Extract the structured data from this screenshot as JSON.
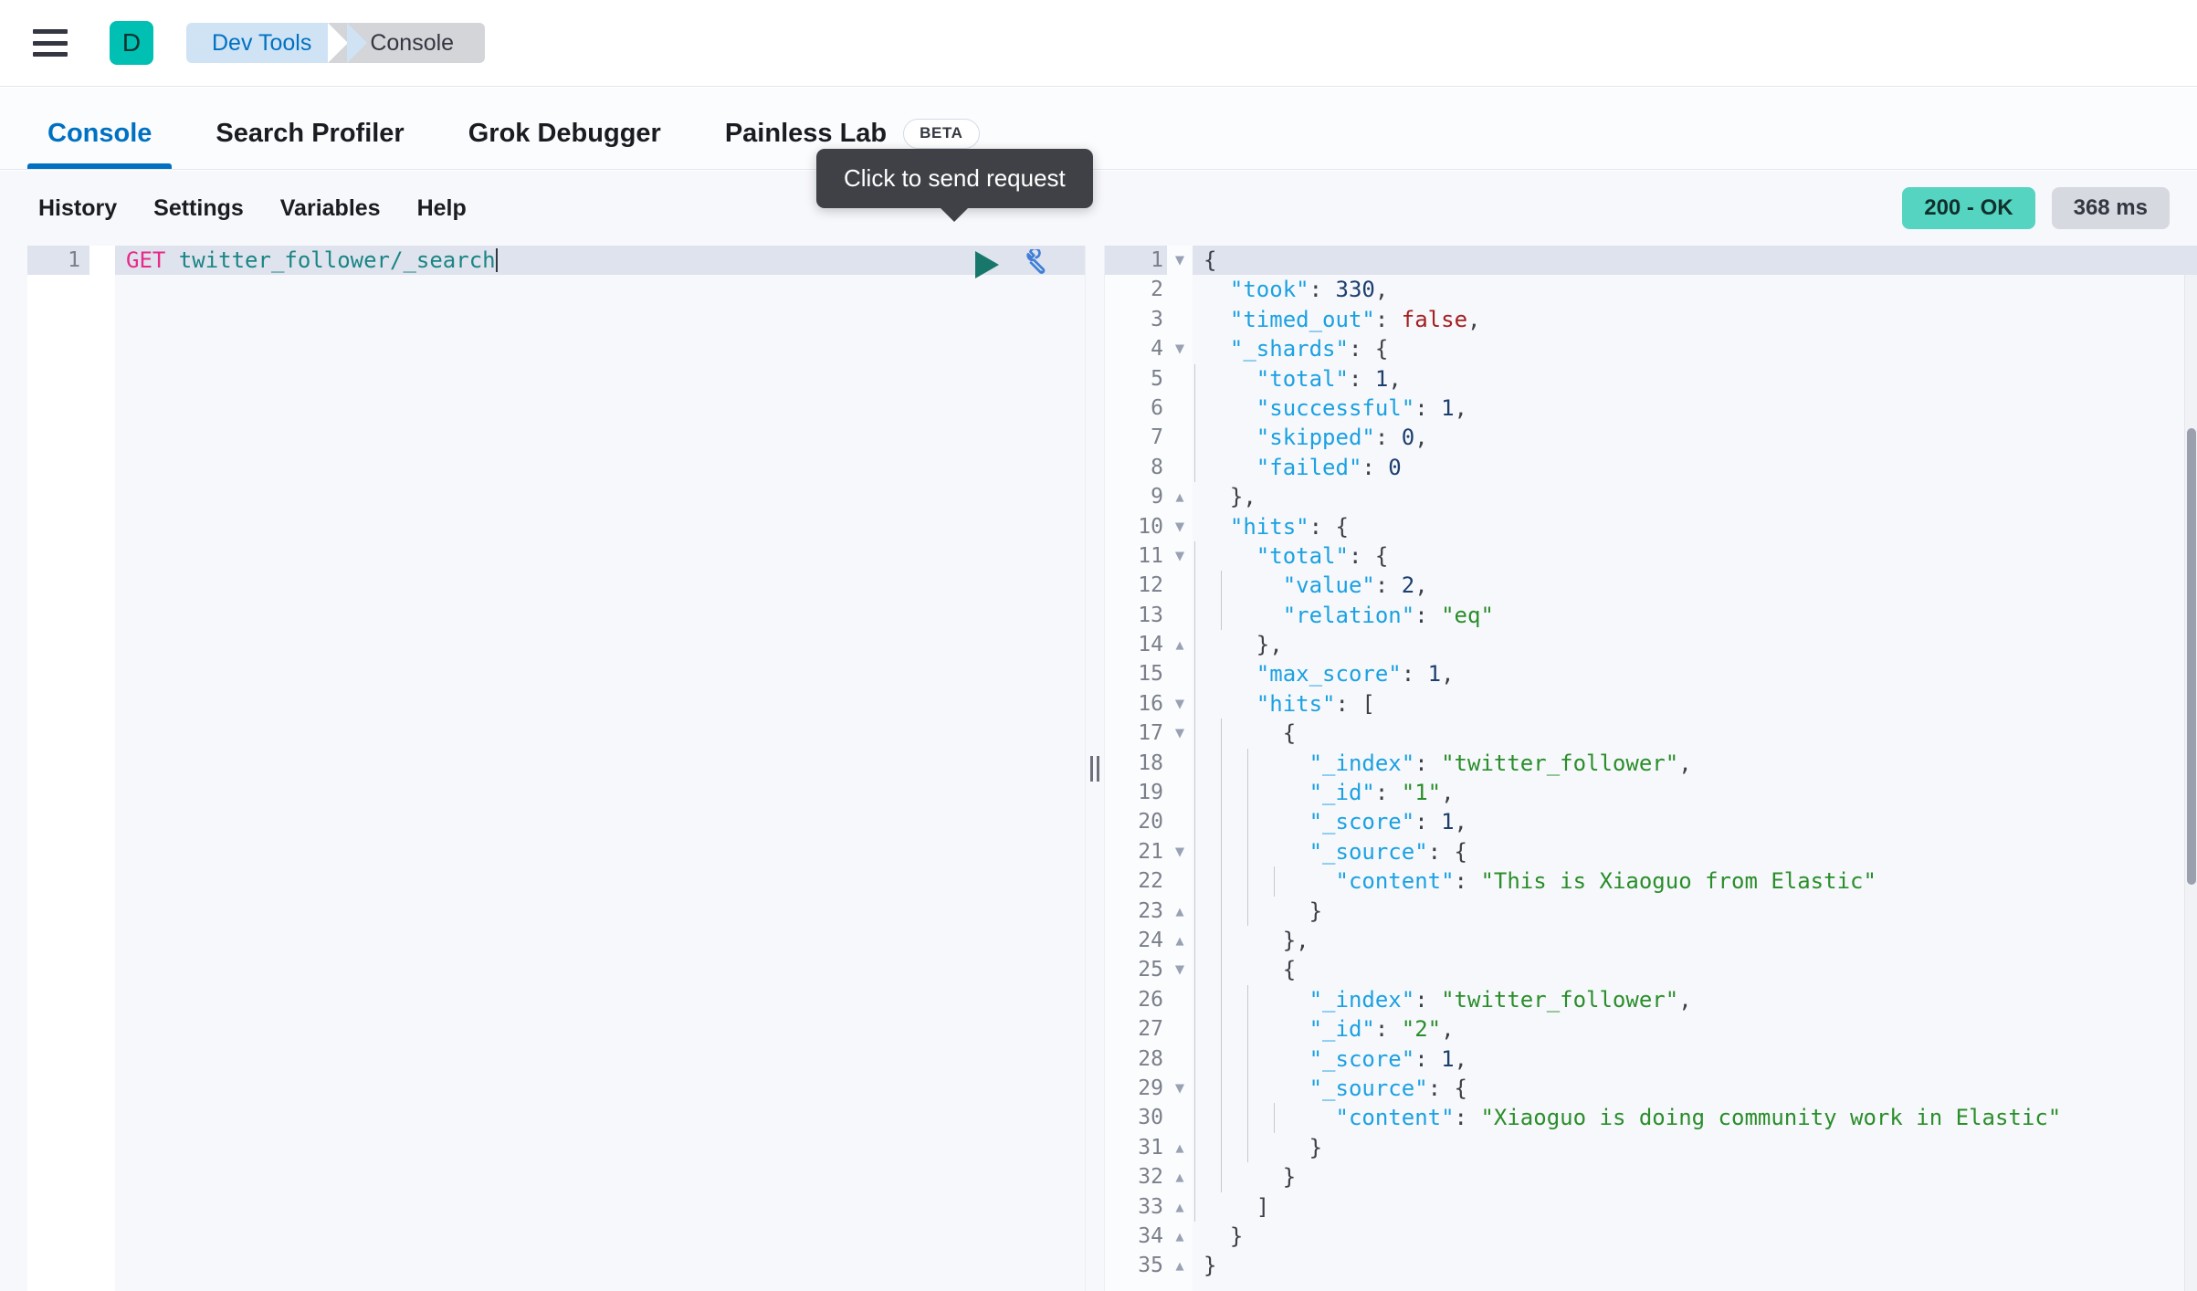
{
  "chrome": {
    "menu_icon": "hamburger-menu-icon",
    "app_badge_letter": "D",
    "breadcrumbs": [
      {
        "label": "Dev Tools",
        "active": true
      },
      {
        "label": "Console",
        "active": false
      }
    ],
    "accent_teal": "#00bfb3",
    "accent_blue": "#0071c2"
  },
  "tabs": [
    {
      "label": "Console",
      "active": true,
      "badge": null
    },
    {
      "label": "Search Profiler",
      "active": false,
      "badge": null
    },
    {
      "label": "Grok Debugger",
      "active": false,
      "badge": null
    },
    {
      "label": "Painless Lab",
      "active": false,
      "badge": "BETA"
    }
  ],
  "action_row": {
    "links": [
      "History",
      "Settings",
      "Variables",
      "Help"
    ],
    "status_code": "200 - OK",
    "status_color": "#54d4c1",
    "duration": "368 ms",
    "duration_color": "#d7d9e0"
  },
  "tooltip": {
    "text": "Click to send request"
  },
  "request_editor": {
    "icons": {
      "send": "play-icon",
      "wrench": "wrench-icon"
    },
    "lines": [
      {
        "n": "1",
        "method": "GET",
        "url": " twitter_follower/_search",
        "active": true
      }
    ]
  },
  "response_editor": {
    "lines": [
      {
        "n": "1",
        "fold": "down",
        "indent": 0,
        "guides": 0,
        "text": "{"
      },
      {
        "n": "2",
        "fold": "",
        "indent": 1,
        "guides": 0,
        "key": "\"took\"",
        "sep": ": ",
        "num": "330",
        "tail": ","
      },
      {
        "n": "3",
        "fold": "",
        "indent": 1,
        "guides": 0,
        "key": "\"timed_out\"",
        "sep": ": ",
        "bool": "false",
        "tail": ","
      },
      {
        "n": "4",
        "fold": "down",
        "indent": 1,
        "guides": 0,
        "key": "\"_shards\"",
        "sep": ": ",
        "text": "{"
      },
      {
        "n": "5",
        "fold": "",
        "indent": 2,
        "guides": 1,
        "key": "\"total\"",
        "sep": ": ",
        "num": "1",
        "tail": ","
      },
      {
        "n": "6",
        "fold": "",
        "indent": 2,
        "guides": 1,
        "key": "\"successful\"",
        "sep": ": ",
        "num": "1",
        "tail": ","
      },
      {
        "n": "7",
        "fold": "",
        "indent": 2,
        "guides": 1,
        "key": "\"skipped\"",
        "sep": ": ",
        "num": "0",
        "tail": ","
      },
      {
        "n": "8",
        "fold": "",
        "indent": 2,
        "guides": 1,
        "key": "\"failed\"",
        "sep": ": ",
        "num": "0",
        "tail": ""
      },
      {
        "n": "9",
        "fold": "up",
        "indent": 1,
        "guides": 0,
        "text": "},"
      },
      {
        "n": "10",
        "fold": "down",
        "indent": 1,
        "guides": 0,
        "key": "\"hits\"",
        "sep": ": ",
        "text": "{"
      },
      {
        "n": "11",
        "fold": "down",
        "indent": 2,
        "guides": 1,
        "key": "\"total\"",
        "sep": ": ",
        "text": "{"
      },
      {
        "n": "12",
        "fold": "",
        "indent": 3,
        "guides": 2,
        "key": "\"value\"",
        "sep": ": ",
        "num": "2",
        "tail": ","
      },
      {
        "n": "13",
        "fold": "",
        "indent": 3,
        "guides": 2,
        "key": "\"relation\"",
        "sep": ": ",
        "str": "\"eq\"",
        "tail": ""
      },
      {
        "n": "14",
        "fold": "up",
        "indent": 2,
        "guides": 1,
        "text": "},"
      },
      {
        "n": "15",
        "fold": "",
        "indent": 2,
        "guides": 1,
        "key": "\"max_score\"",
        "sep": ": ",
        "num": "1",
        "tail": ","
      },
      {
        "n": "16",
        "fold": "down",
        "indent": 2,
        "guides": 1,
        "key": "\"hits\"",
        "sep": ": ",
        "text": "["
      },
      {
        "n": "17",
        "fold": "down",
        "indent": 3,
        "guides": 2,
        "text": "{"
      },
      {
        "n": "18",
        "fold": "",
        "indent": 4,
        "guides": 3,
        "key": "\"_index\"",
        "sep": ": ",
        "str": "\"twitter_follower\"",
        "tail": ","
      },
      {
        "n": "19",
        "fold": "",
        "indent": 4,
        "guides": 3,
        "key": "\"_id\"",
        "sep": ": ",
        "str": "\"1\"",
        "tail": ","
      },
      {
        "n": "20",
        "fold": "",
        "indent": 4,
        "guides": 3,
        "key": "\"_score\"",
        "sep": ": ",
        "num": "1",
        "tail": ","
      },
      {
        "n": "21",
        "fold": "down",
        "indent": 4,
        "guides": 3,
        "key": "\"_source\"",
        "sep": ": ",
        "text": "{"
      },
      {
        "n": "22",
        "fold": "",
        "indent": 5,
        "guides": 4,
        "key": "\"content\"",
        "sep": ": ",
        "str": "\"This is Xiaoguo from Elastic\"",
        "tail": ""
      },
      {
        "n": "23",
        "fold": "up",
        "indent": 4,
        "guides": 3,
        "text": "}"
      },
      {
        "n": "24",
        "fold": "up",
        "indent": 3,
        "guides": 2,
        "text": "},"
      },
      {
        "n": "25",
        "fold": "down",
        "indent": 3,
        "guides": 2,
        "text": "{"
      },
      {
        "n": "26",
        "fold": "",
        "indent": 4,
        "guides": 3,
        "key": "\"_index\"",
        "sep": ": ",
        "str": "\"twitter_follower\"",
        "tail": ","
      },
      {
        "n": "27",
        "fold": "",
        "indent": 4,
        "guides": 3,
        "key": "\"_id\"",
        "sep": ": ",
        "str": "\"2\"",
        "tail": ","
      },
      {
        "n": "28",
        "fold": "",
        "indent": 4,
        "guides": 3,
        "key": "\"_score\"",
        "sep": ": ",
        "num": "1",
        "tail": ","
      },
      {
        "n": "29",
        "fold": "down",
        "indent": 4,
        "guides": 3,
        "key": "\"_source\"",
        "sep": ": ",
        "text": "{"
      },
      {
        "n": "30",
        "fold": "",
        "indent": 5,
        "guides": 4,
        "key": "\"content\"",
        "sep": ": ",
        "str": "\"Xiaoguo is doing community work in Elastic\"",
        "tail": ""
      },
      {
        "n": "31",
        "fold": "up",
        "indent": 4,
        "guides": 3,
        "text": "}"
      },
      {
        "n": "32",
        "fold": "up",
        "indent": 3,
        "guides": 2,
        "text": "}"
      },
      {
        "n": "33",
        "fold": "up",
        "indent": 2,
        "guides": 1,
        "text": "]"
      },
      {
        "n": "34",
        "fold": "up",
        "indent": 1,
        "guides": 0,
        "text": "}"
      },
      {
        "n": "35",
        "fold": "up",
        "indent": 0,
        "guides": 0,
        "text": "}"
      }
    ]
  },
  "splitter": {
    "name": "pane-resize-handle"
  },
  "scrollbar": {
    "name": "response-vertical-scrollbar"
  }
}
